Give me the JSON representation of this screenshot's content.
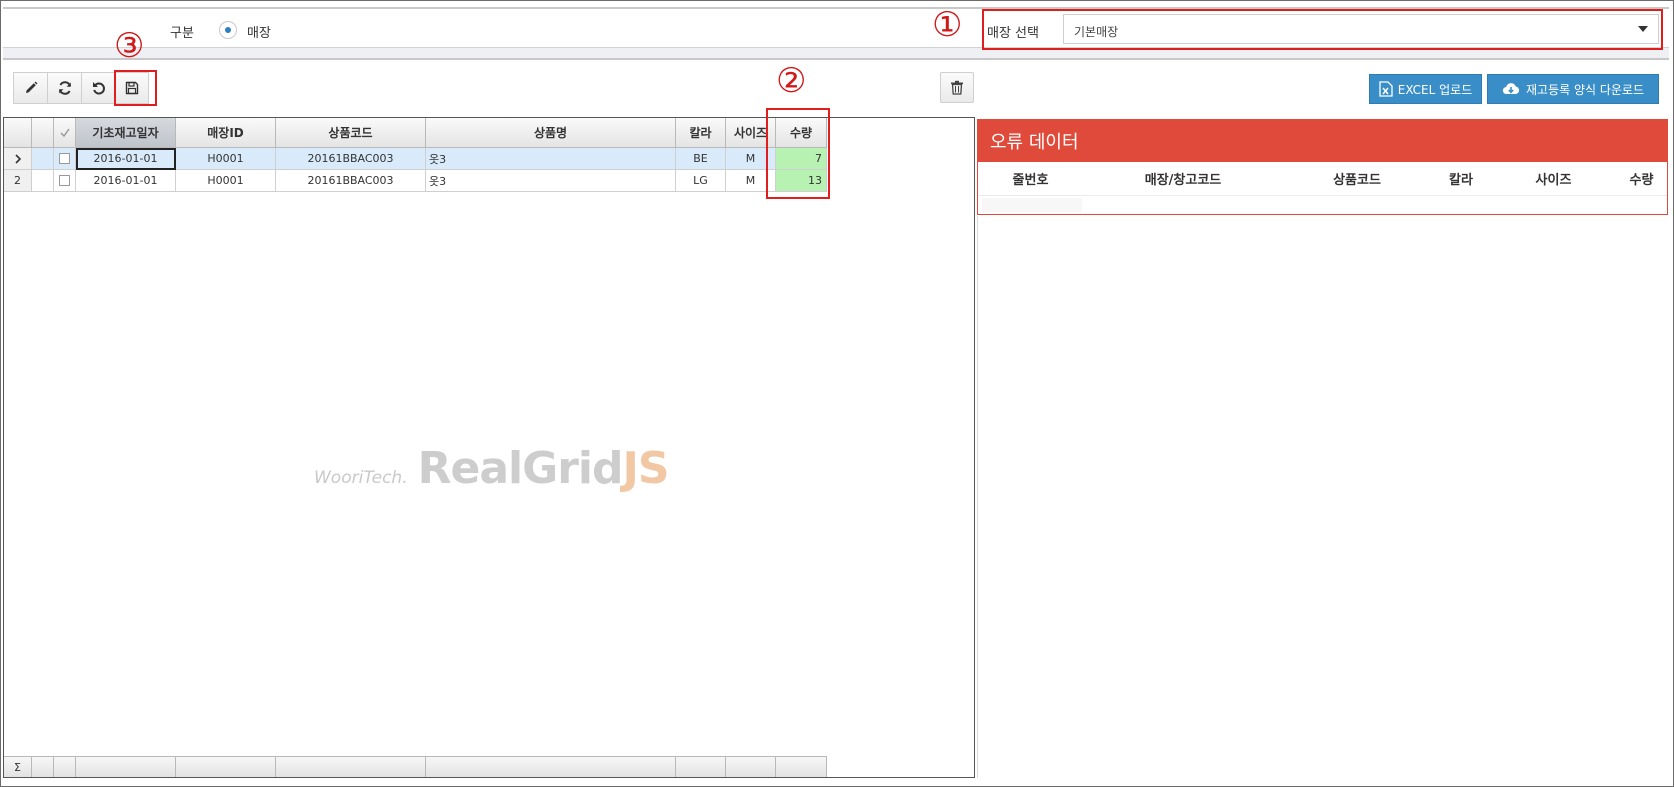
{
  "filter": {
    "gubun_label": "구분",
    "radio_label": "매장",
    "store_label": "매장 선택",
    "store_value": "기본매장"
  },
  "annotations": {
    "one": "①",
    "two": "②",
    "three": "③"
  },
  "actions": {
    "excel_upload": "EXCEL 업로드",
    "template_download": "재고등록 양식 다운로드"
  },
  "grid": {
    "columns": [
      "기초재고일자",
      "매장ID",
      "상품코드",
      "상품명",
      "칼라",
      "사이즈",
      "수량"
    ],
    "rows": [
      {
        "indicator": ">",
        "date": "2016-01-01",
        "store_id": "H0001",
        "code": "20161BBAC003",
        "name": "옷3",
        "color": "BE",
        "size": "M",
        "qty": "7"
      },
      {
        "indicator": "2",
        "date": "2016-01-01",
        "store_id": "H0001",
        "code": "20161BBAC003",
        "name": "옷3",
        "color": "LG",
        "size": "M",
        "qty": "13"
      }
    ],
    "footer_symbol": "Σ"
  },
  "watermark": {
    "company": "WooriTech.",
    "product": "RealGrid",
    "suffix": "JS"
  },
  "error_panel": {
    "title": "오류 데이터",
    "columns": [
      "줄번호",
      "매장/창고코드",
      "상품코드",
      "칼라",
      "사이즈",
      "수량"
    ]
  },
  "colors": {
    "accent": "#3a8ec7",
    "error_header": "#e04a3a",
    "annotation": "#e01e1e",
    "qty_cell": "#b7f2b3"
  }
}
